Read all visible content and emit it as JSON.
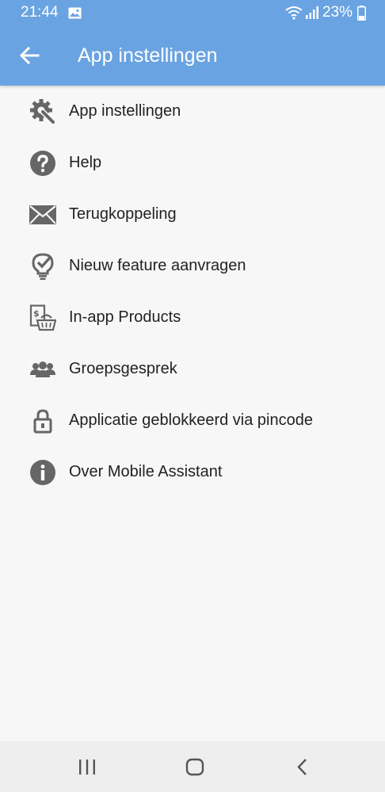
{
  "status": {
    "time": "21:44",
    "battery": "23%"
  },
  "appbar": {
    "title": "App instellingen"
  },
  "menu": {
    "items": [
      {
        "label": "App instellingen",
        "icon": "gear-wrench-icon"
      },
      {
        "label": "Help",
        "icon": "help-icon"
      },
      {
        "label": "Terugkoppeling",
        "icon": "envelope-icon"
      },
      {
        "label": "Nieuw feature aanvragen",
        "icon": "lightbulb-check-icon"
      },
      {
        "label": "In-app Products",
        "icon": "shop-basket-icon"
      },
      {
        "label": "Groepsgesprek",
        "icon": "group-icon"
      },
      {
        "label": "Applicatie geblokkeerd via pincode",
        "icon": "lock-icon"
      },
      {
        "label": "Over Mobile Assistant",
        "icon": "info-icon"
      }
    ]
  },
  "colors": {
    "appbar": "#6aa3e1",
    "icon": "#666666",
    "background": "#f7f7f7"
  }
}
